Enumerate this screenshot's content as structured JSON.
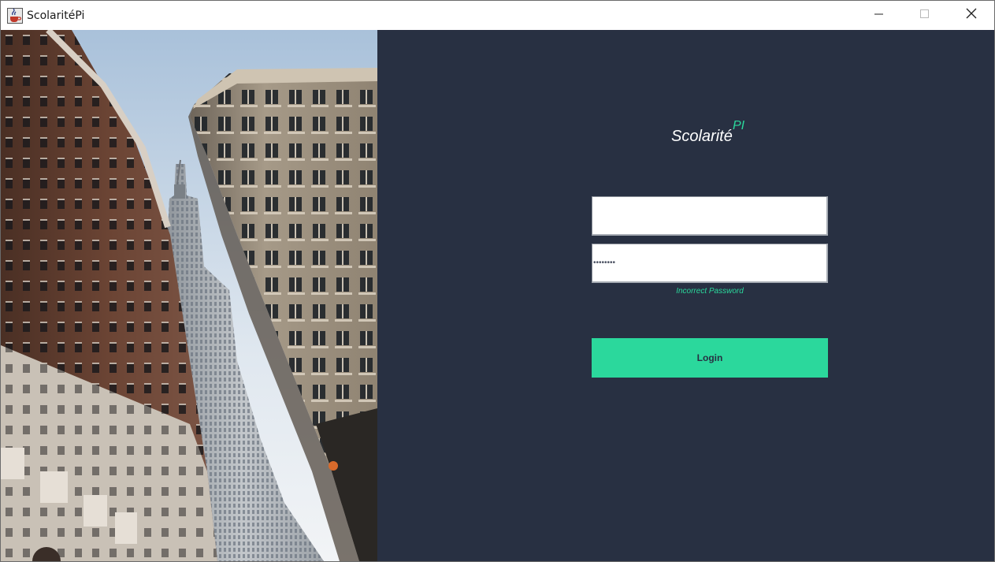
{
  "window": {
    "title": "ScolaritéPi",
    "icon": "java-coffee-cup-icon",
    "controls": [
      "minimize-icon",
      "maximize-icon",
      "close-icon"
    ]
  },
  "photo": {
    "description_icon": "city-buildings-photo"
  },
  "login": {
    "brand_name": "Scolarité",
    "brand_superscript": "PI",
    "username_value": "",
    "password_value": "••••••••",
    "error_message": "Incorrect Password",
    "login_label": "Login"
  },
  "colors": {
    "panel_background": "#283042",
    "accent": "#2bd89c",
    "input_background": "#ffffff"
  }
}
